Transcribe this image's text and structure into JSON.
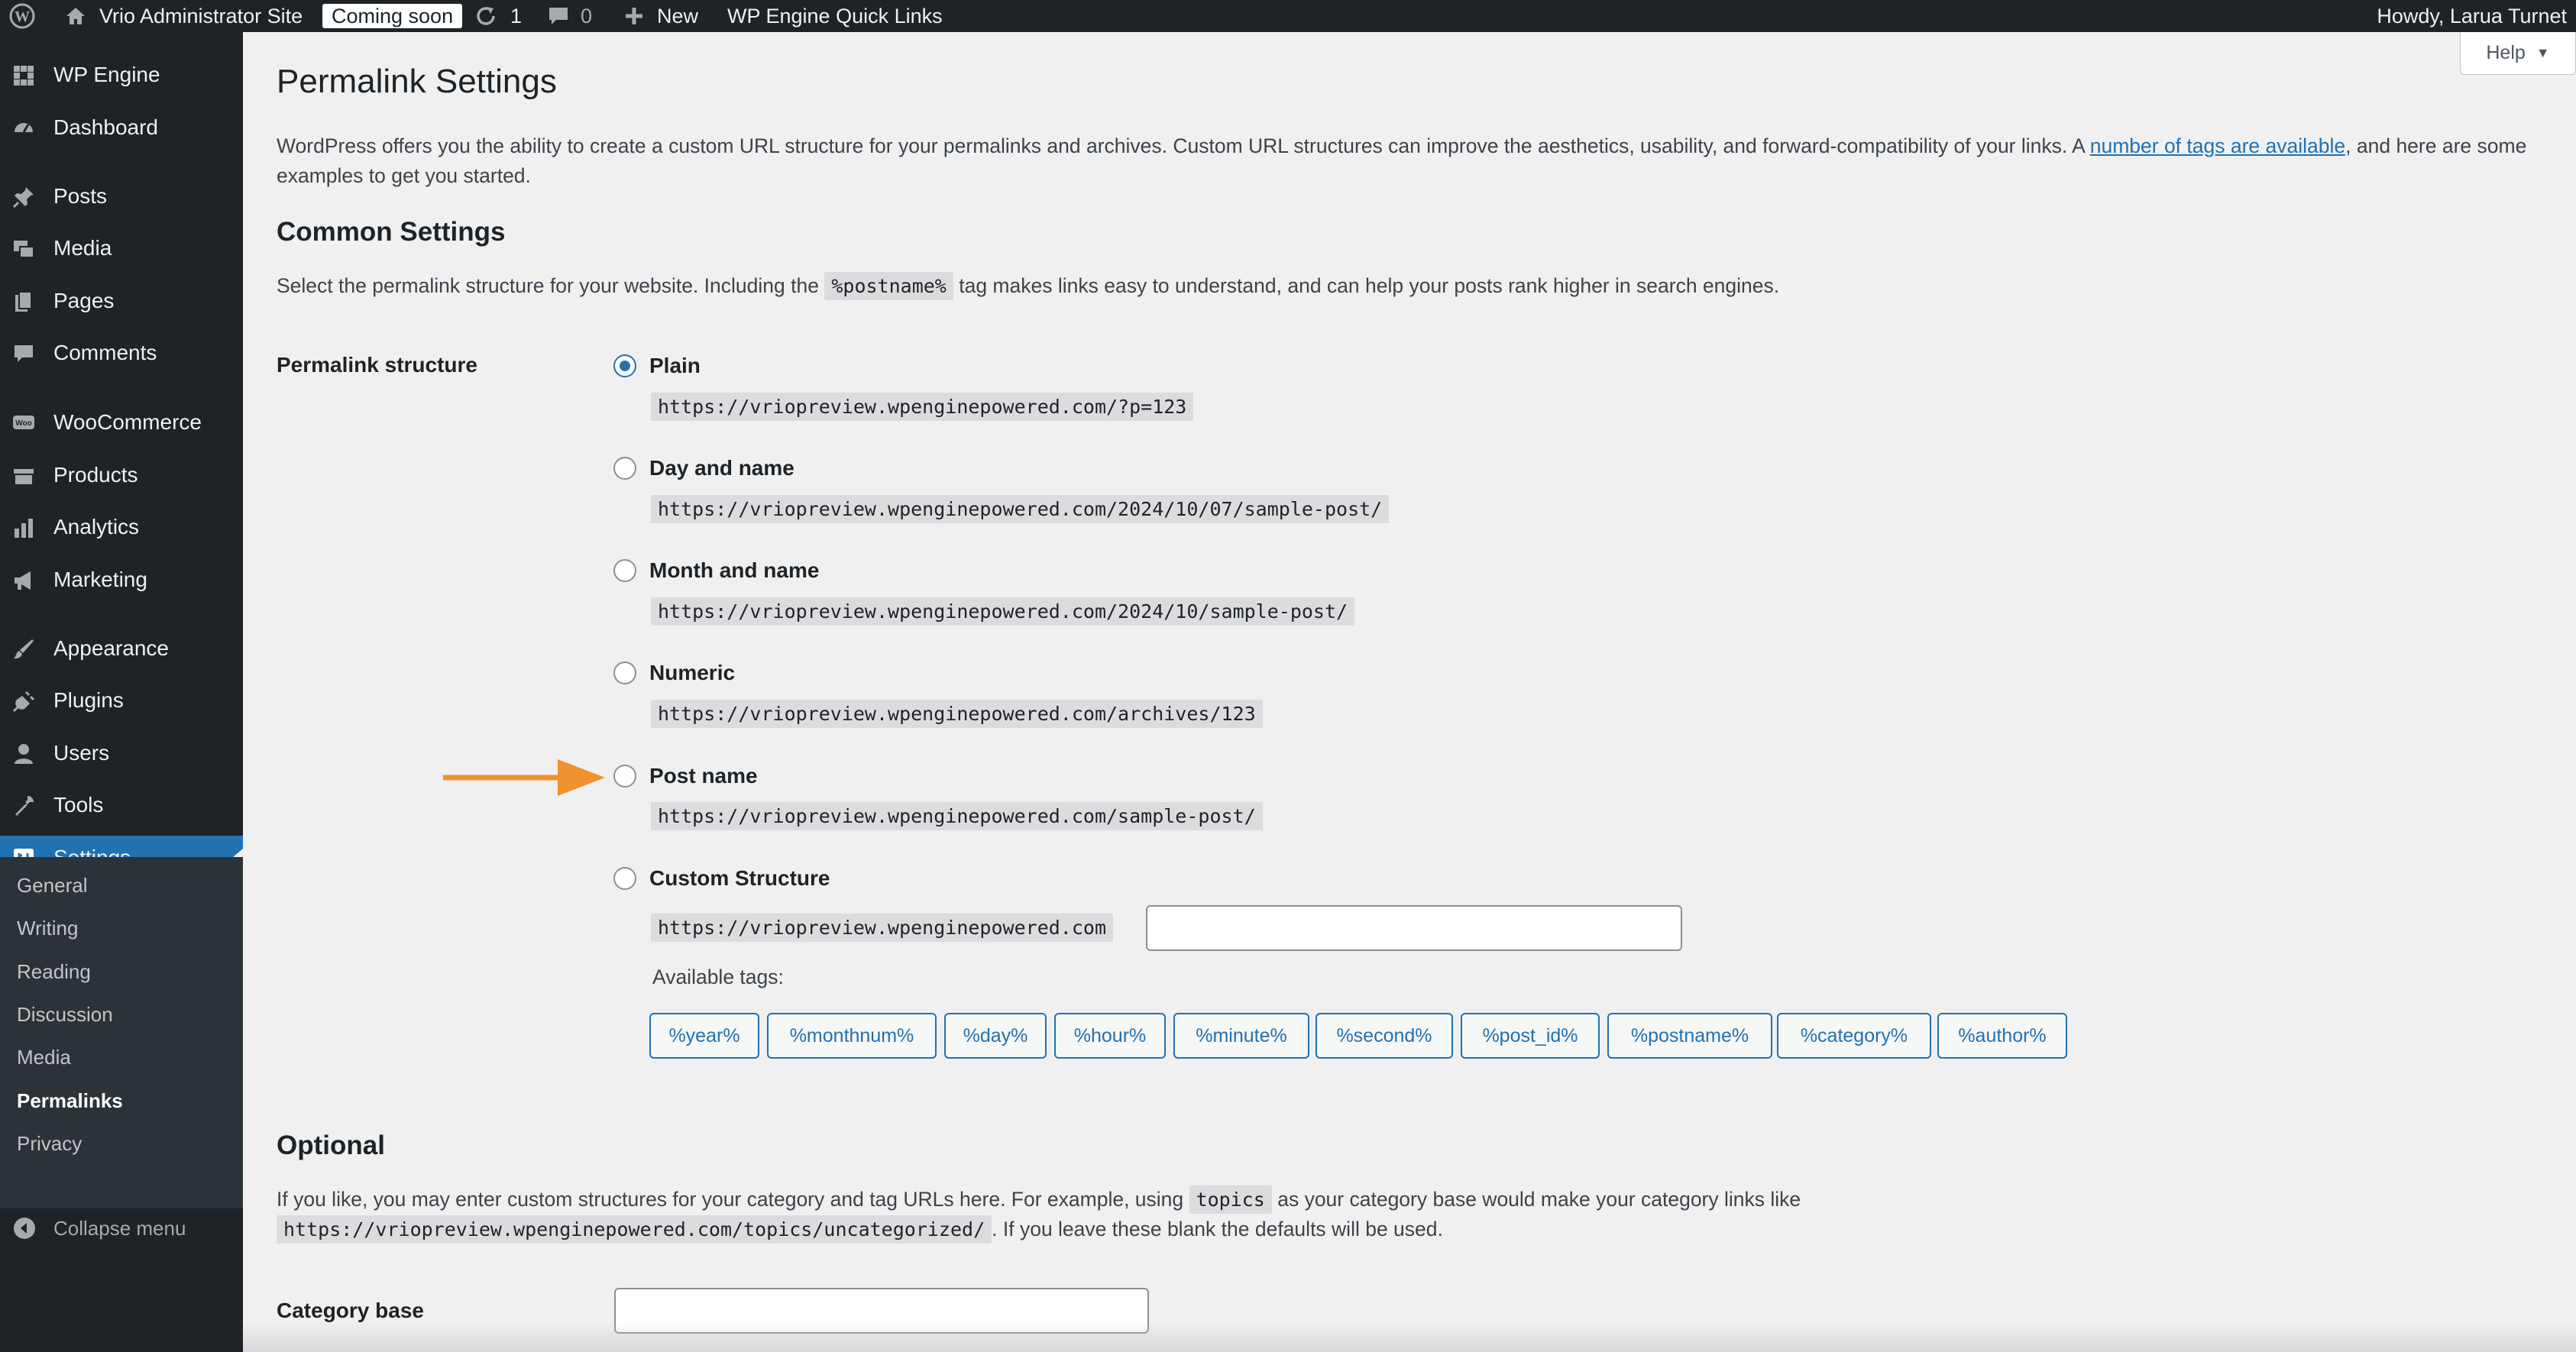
{
  "adminbar": {
    "site_name": "Vrio Administrator Site",
    "coming_soon": "Coming soon",
    "updates_count": "1",
    "comments_count": "0",
    "new_label": "New",
    "quick_links": "WP Engine Quick Links",
    "howdy": "Howdy, Larua Turnet"
  },
  "sidebar": {
    "items": [
      {
        "label": "WP Engine",
        "icon": "wp-engine-icon"
      },
      {
        "label": "Dashboard",
        "icon": "dashboard-icon"
      },
      {
        "label": "Posts",
        "icon": "pin-icon"
      },
      {
        "label": "Media",
        "icon": "media-icon"
      },
      {
        "label": "Pages",
        "icon": "pages-icon"
      },
      {
        "label": "Comments",
        "icon": "comment-icon"
      },
      {
        "label": "WooCommerce",
        "icon": "woocommerce-icon"
      },
      {
        "label": "Products",
        "icon": "products-icon"
      },
      {
        "label": "Analytics",
        "icon": "bar-chart-icon"
      },
      {
        "label": "Marketing",
        "icon": "megaphone-icon"
      },
      {
        "label": "Appearance",
        "icon": "brush-icon"
      },
      {
        "label": "Plugins",
        "icon": "plug-icon"
      },
      {
        "label": "Users",
        "icon": "user-icon"
      },
      {
        "label": "Tools",
        "icon": "wrench-icon"
      },
      {
        "label": "Settings",
        "icon": "settings-icon"
      }
    ],
    "submenu": [
      "General",
      "Writing",
      "Reading",
      "Discussion",
      "Media",
      "Permalinks",
      "Privacy"
    ],
    "collapse_label": "Collapse menu"
  },
  "help_label": "Help",
  "main": {
    "title": "Permalink Settings",
    "intro_before_link": "WordPress offers you the ability to create a custom URL structure for your permalinks and archives. Custom URL structures can improve the aesthetics, usability, and forward-compatibility of your links. A",
    "intro_link": "number of tags are available",
    "intro_after_link": ", and here are some examples to get you started.",
    "common_heading": "Common Settings",
    "common_desc_before": "Select the permalink structure for your website. Including the",
    "common_desc_code": "%postname%",
    "common_desc_after": "tag makes links easy to understand, and can help your posts rank higher in search engines.",
    "structure_label": "Permalink structure",
    "options": [
      {
        "label": "Plain",
        "example": "https://vriopreview.wpenginepowered.com/?p=123",
        "selected": true
      },
      {
        "label": "Day and name",
        "example": "https://vriopreview.wpenginepowered.com/2024/10/07/sample-post/",
        "selected": false
      },
      {
        "label": "Month and name",
        "example": "https://vriopreview.wpenginepowered.com/2024/10/sample-post/",
        "selected": false
      },
      {
        "label": "Numeric",
        "example": "https://vriopreview.wpenginepowered.com/archives/123",
        "selected": false
      },
      {
        "label": "Post name",
        "example": "https://vriopreview.wpenginepowered.com/sample-post/",
        "selected": false
      },
      {
        "label": "Custom Structure",
        "example": "https://vriopreview.wpenginepowered.com",
        "selected": false
      }
    ],
    "custom_value": "",
    "available_tags_label": "Available tags:",
    "tags": [
      "%year%",
      "%monthnum%",
      "%day%",
      "%hour%",
      "%minute%",
      "%second%",
      "%post_id%",
      "%postname%",
      "%category%",
      "%author%"
    ],
    "optional_heading": "Optional",
    "optional_desc_before": "If you like, you may enter custom structures for your category and tag URLs here. For example, using",
    "optional_desc_code": "topics",
    "optional_desc_after": "as your category base would make your category links like",
    "optional_example": "https://vriopreview.wpenginepowered.com/topics/uncategorized/",
    "optional_desc_end": ". If you leave these blank the defaults will be used.",
    "category_base_label": "Category base",
    "category_base_value": ""
  },
  "colors": {
    "accent": "#2271b1",
    "arrow": "#f0922e",
    "sidebar_bg": "#1d2327"
  }
}
